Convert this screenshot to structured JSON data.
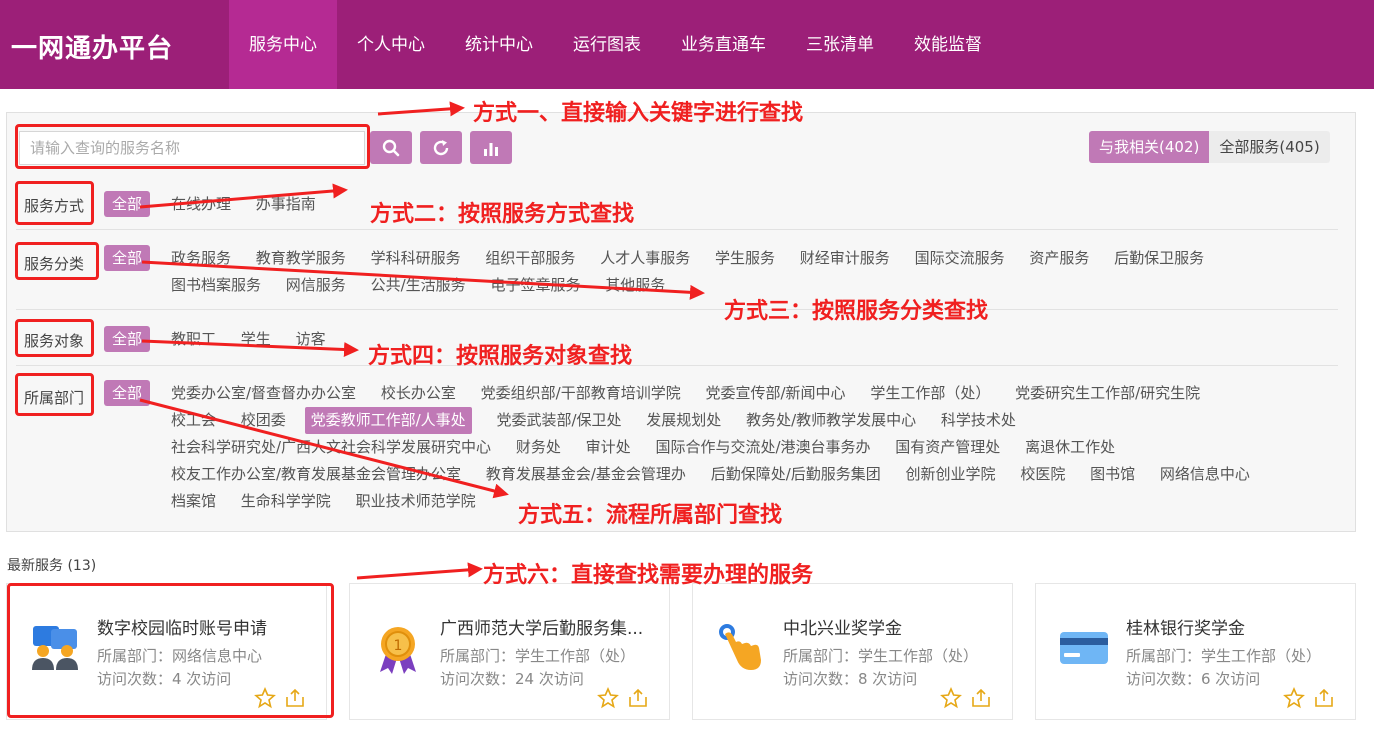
{
  "header": {
    "logo": "一网通办平台",
    "nav": [
      "服务中心",
      "个人中心",
      "统计中心",
      "运行图表",
      "业务直通车",
      "三张清单",
      "效能监督"
    ],
    "active_index": 0,
    "bg_color": "#9c1f78"
  },
  "search": {
    "placeholder": "请输入查询的服务名称",
    "icons": [
      "search-icon",
      "refresh-icon",
      "bar-chart-icon"
    ]
  },
  "scope": {
    "mine": "与我相关(402)",
    "all": "全部服务(405)"
  },
  "filters": {
    "all_label": "全部",
    "service_mode": {
      "label": "服务方式",
      "options": [
        "在线办理",
        "办事指南"
      ]
    },
    "service_category": {
      "label": "服务分类",
      "options": [
        "政务服务",
        "教育教学服务",
        "学科科研服务",
        "组织干部服务",
        "人才人事服务",
        "学生服务",
        "财经审计服务",
        "国际交流服务",
        "资产服务",
        "后勤保卫服务",
        "图书档案服务",
        "网信服务",
        "公共/生活服务",
        "电子签章服务",
        "其他服务"
      ]
    },
    "service_target": {
      "label": "服务对象",
      "options": [
        "教职工",
        "学生",
        "访客"
      ]
    },
    "department": {
      "label": "所属部门",
      "options": [
        "党委办公室/督查督办办公室",
        "校长办公室",
        "党委组织部/干部教育培训学院",
        "党委宣传部/新闻中心",
        "学生工作部（处）",
        "党委研究生工作部/研究生院",
        "校工会",
        "校团委",
        "党委教师工作部/人事处",
        "党委武装部/保卫处",
        "发展规划处",
        "教务处/教师教学发展中心",
        "科学技术处",
        "社会科学研究处/广西人文社会科学发展研究中心",
        "财务处",
        "审计处",
        "国际合作与交流处/港澳台事务办",
        "国有资产管理处",
        "离退休工作处",
        "校友工作办公室/教育发展基金会管理办公室",
        "教育发展基金会/基金会管理办",
        "后勤保障处/后勤服务集团",
        "创新创业学院",
        "校医院",
        "图书馆",
        "网络信息中心",
        "档案馆",
        "生命科学学院",
        "职业技术师范学院"
      ],
      "selected": "党委教师工作部/人事处"
    }
  },
  "callouts": {
    "c1": "方式一、直接输入关键字进行查找",
    "c2": "方式二：按照服务方式查找",
    "c3": "方式三：按照服务分类查找",
    "c4": "方式四：按照服务对象查找",
    "c5": "方式五：流程所属部门查找",
    "c6": "方式六：直接查找需要办理的服务"
  },
  "latest": {
    "title": "最新服务 (13)",
    "cards": [
      {
        "icon": "user-group-icon",
        "title": "数字校园临时账号申请",
        "dept": "所属部门：网络信息中心",
        "visits": "访问次数：4 次访问"
      },
      {
        "icon": "medal-icon",
        "title": "广西师范大学后勤服务集...",
        "dept": "所属部门：学生工作部（处）",
        "visits": "访问次数：24 次访问"
      },
      {
        "icon": "hand-click-icon",
        "title": "中北兴业奖学金",
        "dept": "所属部门：学生工作部（处）",
        "visits": "访问次数：8 次访问"
      },
      {
        "icon": "bank-card-icon",
        "title": "桂林银行奖学金",
        "dept": "所属部门：学生工作部（处）",
        "visits": "访问次数：6 次访问"
      }
    ]
  },
  "colors": {
    "accent": "#c079b6",
    "callout": "#f02020",
    "action_icon": "#e6a817"
  }
}
